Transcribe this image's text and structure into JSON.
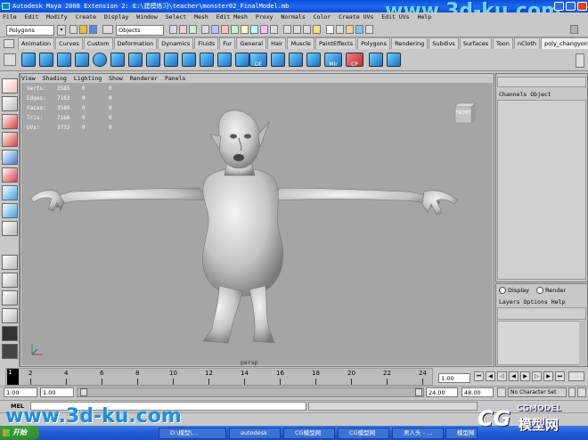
{
  "window": {
    "title": "Autodesk Maya 2008 Extension 2: E:\\建模练习\\teacher\\monster02_FinalModel.mb",
    "watermark": "www.3d-ku.com"
  },
  "menubar": {
    "items": [
      "File",
      "Edit",
      "Modify",
      "Create",
      "Display",
      "Window",
      "Select",
      "Mesh",
      "Edit Mesh",
      "Proxy",
      "Normals",
      "Color",
      "Create UVs",
      "Edit UVs",
      "Help"
    ]
  },
  "status_line": {
    "menu_set": "Polygons",
    "selection_mask": "Objects"
  },
  "shelf": {
    "tabs": [
      "Animation",
      "Curves",
      "Custom",
      "Deformation",
      "Dynamics",
      "Fluids",
      "Fur",
      "General",
      "Hair",
      "Muscle",
      "PaintEffects",
      "Polygons",
      "Rendering",
      "Subdivs",
      "Surfaces",
      "Toon",
      "nCloth",
      "poly_changyong"
    ],
    "active_tab": "poly_changyong",
    "icon_labels": [
      "DE",
      "Mir",
      "CP"
    ]
  },
  "viewport": {
    "menu": [
      "View",
      "Shading",
      "Lighting",
      "Show",
      "Renderer",
      "Panels"
    ],
    "hud": [
      {
        "label": "Verts:",
        "v1": "3585",
        "v2": "0",
        "v3": "0"
      },
      {
        "label": "Edges:",
        "v1": "7163",
        "v2": "0",
        "v3": "0"
      },
      {
        "label": "Faces:",
        "v1": "3580",
        "v2": "0",
        "v3": "0"
      },
      {
        "label": "Tris:",
        "v1": "7166",
        "v2": "0",
        "v3": "0"
      },
      {
        "label": "UVs:",
        "v1": "3732",
        "v2": "0",
        "v3": "0"
      }
    ],
    "view_cube_label": "FRONT",
    "camera_label": "persp"
  },
  "channel_box": {
    "header": "Channels Object"
  },
  "layer_editor": {
    "display_label": "Display",
    "render_label": "Render",
    "menu": "Layers Options Help"
  },
  "timeline": {
    "current_frame": "1",
    "labels": [
      "2",
      "4",
      "6",
      "8",
      "10",
      "12",
      "14",
      "16",
      "18",
      "20",
      "22",
      "24"
    ],
    "current_time": "1.00"
  },
  "range_slider": {
    "start": "1.00",
    "anim_start": "1.00",
    "range_end": "24.00",
    "anim_end": "48.00",
    "character_set": "No Character Set"
  },
  "command_line": {
    "label": "MEL"
  },
  "taskbar": {
    "start_label": "开始",
    "tasks": [
      "D:\\模型\\…",
      "autodesk",
      "CG模型网",
      "CG模型网",
      "男人头 - …",
      "模型网 -…"
    ]
  },
  "watermark_bottom": {
    "url": "www.3d-ku.com",
    "brand": "CGMODEL",
    "brand_cn": "模型网"
  },
  "colors": {
    "title_blue": "#1f6af2",
    "viewport_bg": "#a5a5a5",
    "panel_gray": "#c8c8c8",
    "taskbar_blue": "#245ed8",
    "start_green": "#3d9e3d"
  }
}
